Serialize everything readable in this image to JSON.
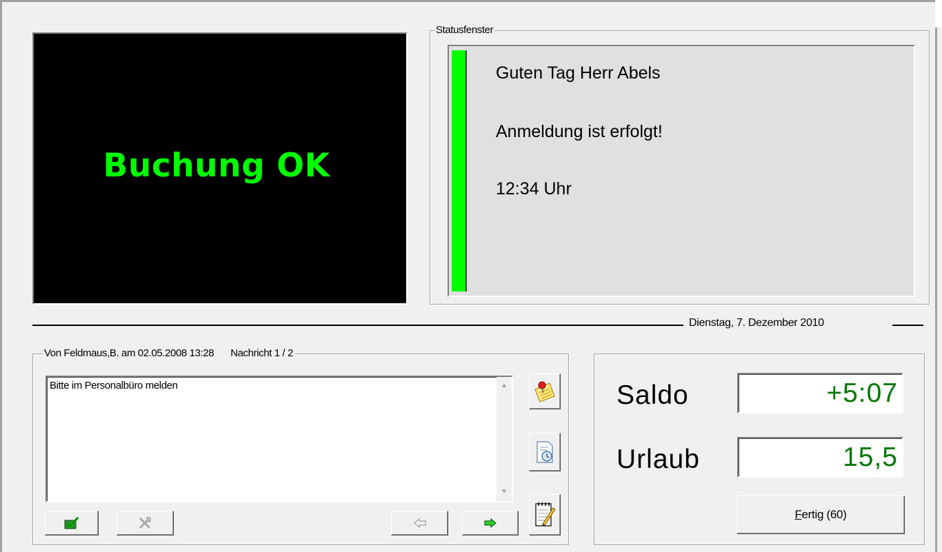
{
  "display": {
    "text": "Buchung OK",
    "color": "#00ff00"
  },
  "status": {
    "legend": "Statusfenster",
    "indicator_color": "#00ff00",
    "lines": [
      "Guten Tag Herr Abels",
      "Anmeldung ist erfolgt!",
      "12:34 Uhr"
    ]
  },
  "date": {
    "label": "Dienstag, 7. Dezember 2010"
  },
  "message": {
    "sender": "Von Feldmaus,B.  am 02.05.2008 13:28",
    "count": "Nachricht 1 / 2",
    "body": "Bitte im Personalbüro melden",
    "buttons": {
      "accept_icon": "checkmark-icon",
      "delete_icon": "delete-icon",
      "prev_icon": "arrow-left-icon",
      "next_icon": "arrow-right-icon",
      "pin_icon": "pinned-note-icon",
      "schedule_icon": "document-clock-icon",
      "notepad_icon": "notepad-pencil-icon"
    }
  },
  "balance": {
    "saldo_label": "Saldo",
    "saldo_value": "+5:07",
    "urlaub_label": "Urlaub",
    "urlaub_value": "15,5",
    "value_color": "#007700",
    "done_mnemonic": "F",
    "done_rest": "ertig (60)"
  }
}
